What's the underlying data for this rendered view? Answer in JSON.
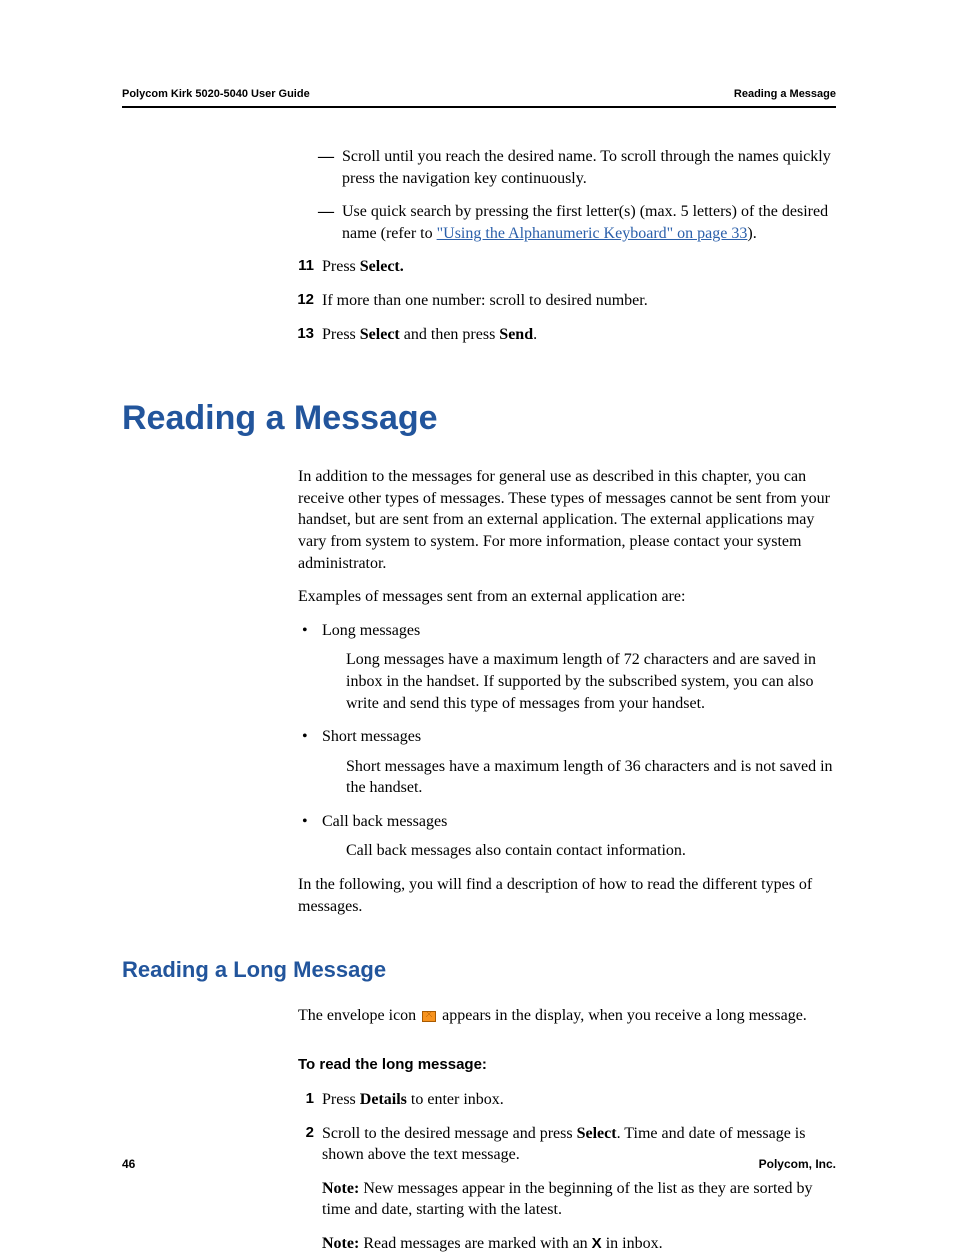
{
  "header": {
    "left": "Polycom Kirk 5020-5040 User Guide",
    "right": "Reading a Message"
  },
  "top": {
    "dash1": "Scroll until you reach the desired name. To scroll through the names quickly press the navigation key continuously.",
    "dash2a": "Use quick search by pressing the first letter(s) (max. 5 letters) of the desired name (refer to ",
    "dash2_link": "\"Using the Alphanumeric Keyboard\" on page 33",
    "dash2b": ").",
    "s11a": "Press ",
    "s11b": "Select.",
    "s12": "If more than one number: scroll to desired number.",
    "s13a": "Press ",
    "s13b": "Select",
    "s13c": " and then press ",
    "s13d": "Send",
    "s13e": "."
  },
  "h1": "Reading a Message",
  "intro": {
    "p1": "In addition to the messages for general use as described in this chapter, you can receive other types of messages. These types of messages cannot be sent from your handset, but are sent from an external application. The external applications may vary from system to system. For more information, please contact your system administrator.",
    "p2": "Examples of messages sent from an external application are:",
    "b1t": "Long messages",
    "b1d": "Long messages have a maximum length of 72 characters and are saved in inbox in the handset. If supported by the subscribed system, you can also write and send this type of messages from your handset.",
    "b2t": "Short messages",
    "b2d": "Short messages have a maximum length of 36 characters and is not saved in the handset.",
    "b3t": "Call back messages",
    "b3d": "Call back messages also contain contact information.",
    "p3": "In the following, you will find a description of how to read the different types of messages."
  },
  "h2": "Reading a Long Message",
  "long": {
    "p1a": "The envelope icon ",
    "p1b": " appears in the display, when you receive a long message.",
    "h3": "To read the long message:",
    "s1a": "Press ",
    "s1b": "Details",
    "s1c": " to enter inbox.",
    "s2a": "Scroll to the desired message and press ",
    "s2b": "Select",
    "s2c": ". Time and date of message is shown above the text message.",
    "note1a": "Note:",
    "note1b": " New messages appear in the beginning of the list as they are sorted by time and date, starting with the latest.",
    "note2a": "Note:",
    "note2b": " Read messages are marked with an ",
    "note2c": "X",
    "note2d": " in inbox."
  },
  "footer": {
    "left": "46",
    "right": "Polycom, Inc."
  }
}
